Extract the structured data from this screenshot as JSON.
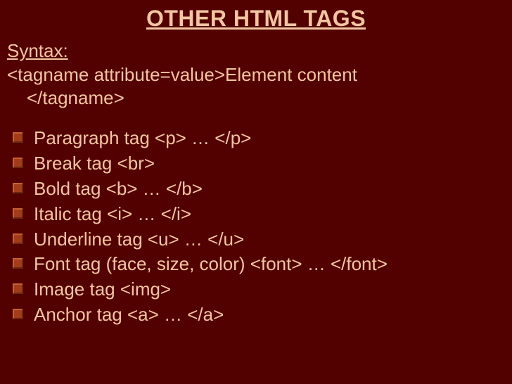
{
  "title": "OTHER HTML TAGS",
  "syntax_label": "Syntax:",
  "syntax_line1": "<tagname attribute=value>Element content",
  "syntax_line2": "</tagname>",
  "items": [
    "Paragraph tag  <p>  …  </p>",
    "Break tag  <br>",
    "Bold tag  <b> … </b>",
    "Italic tag  <i> … </i>",
    "Underline tag  <u> … </u>",
    "Font tag (face, size, color)  <font> … </font>",
    "Image tag  <img>",
    "Anchor tag <a> … </a>"
  ]
}
